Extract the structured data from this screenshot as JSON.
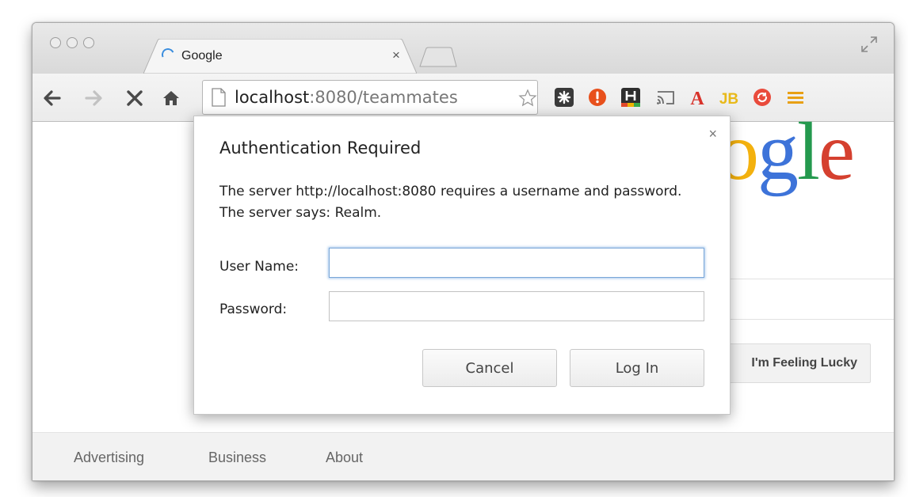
{
  "browser": {
    "tab": {
      "title": "Google",
      "close_label": "×"
    },
    "address_bar": {
      "host": "localhost",
      "rest": ":8080/teammates"
    },
    "icons": {
      "back": "arrow-left-icon",
      "forward": "arrow-right-icon",
      "stop": "stop-x-icon",
      "home": "home-icon",
      "bookmark": "star-icon",
      "menu": "hamburger-menu-icon"
    },
    "extensions": [
      "extension-puzzle-icon",
      "extension-red-circle-icon",
      "extension-h-icon",
      "cast-icon",
      "acrobat-a-icon",
      "jb-icon",
      "sync-icon"
    ]
  },
  "page": {
    "logo_letters": [
      "o",
      "g",
      "l",
      "e"
    ],
    "lucky_button": "I'm Feeling Lucky",
    "footer_links": [
      "Advertising",
      "Business",
      "About"
    ]
  },
  "dialog": {
    "close_label": "×",
    "title": "Authentication Required",
    "message": "The server http://localhost:8080 requires a username and password. The server says: Realm.",
    "username_label": "User Name:",
    "username_value": "",
    "password_label": "Password:",
    "password_value": "",
    "cancel_label": "Cancel",
    "login_label": "Log In"
  },
  "colors": {
    "google_blue": "#3d73d9",
    "google_red": "#d5402f",
    "google_yellow": "#f3b10e",
    "google_green": "#24994e",
    "spinner": "#3b8ede",
    "focus_ring": "#7aa7d8"
  }
}
